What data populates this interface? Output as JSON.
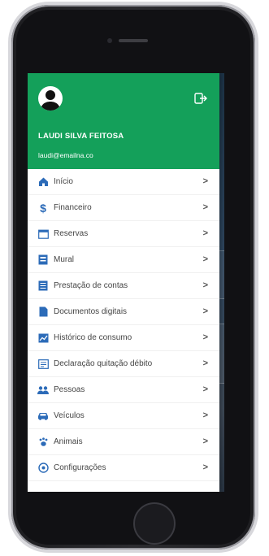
{
  "drawer": {
    "user_name": "LAUDI SILVA FEITOSA",
    "user_email": "laudi@emailna.co"
  },
  "menu": {
    "items": [
      {
        "label": "Início",
        "icon": "home-icon"
      },
      {
        "label": "Financeiro",
        "icon": "dollar-icon"
      },
      {
        "label": "Reservas",
        "icon": "calendar-icon"
      },
      {
        "label": "Mural",
        "icon": "board-icon"
      },
      {
        "label": "Prestação de contas",
        "icon": "ledger-icon"
      },
      {
        "label": "Documentos digitais",
        "icon": "document-icon"
      },
      {
        "label": "Histórico de consumo",
        "icon": "chart-icon"
      },
      {
        "label": "Declaração quitação débito",
        "icon": "receipt-icon"
      },
      {
        "label": "Pessoas",
        "icon": "people-icon"
      },
      {
        "label": "Veículos",
        "icon": "car-icon"
      },
      {
        "label": "Animais",
        "icon": "paw-icon"
      },
      {
        "label": "Configurações",
        "icon": "settings-icon"
      }
    ]
  },
  "colors": {
    "header_green": "#14a05a",
    "icon_blue": "#2c6bb8",
    "badge_red": "#e53935"
  }
}
